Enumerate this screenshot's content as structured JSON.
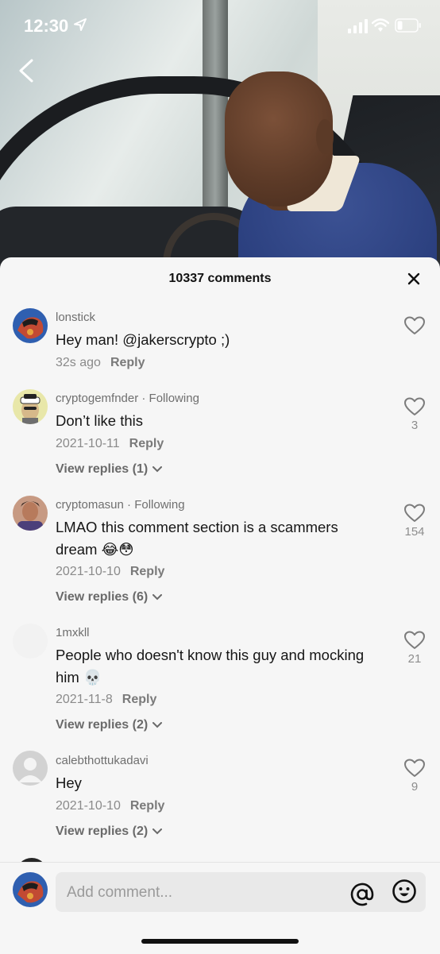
{
  "status_bar": {
    "time": "12:30"
  },
  "sheet": {
    "comment_count_label": "10337 comments"
  },
  "comments": [
    {
      "username": "lonstick",
      "following": "",
      "text": "Hey man! @jakerscrypto ;)",
      "time": "32s ago",
      "reply_label": "Reply",
      "likes": "",
      "view_replies": ""
    },
    {
      "username": "cryptogemfnder",
      "following": " · Following",
      "text": "Don’t like this",
      "time": "2021-10-11",
      "reply_label": "Reply",
      "likes": "3",
      "view_replies": "View replies (1)"
    },
    {
      "username": "cryptomasun",
      "following": " · Following",
      "text": "LMAO this comment section is a scammers dream 😂😳",
      "time": "2021-10-10",
      "reply_label": "Reply",
      "likes": "154",
      "view_replies": "View replies (6)"
    },
    {
      "username": "1mxkll",
      "following": "",
      "text": "People who doesn't know this guy and mocking him 💀",
      "time": "2021-11-8",
      "reply_label": "Reply",
      "likes": "21",
      "view_replies": "View replies (2)"
    },
    {
      "username": "calebthottukadavi",
      "following": "",
      "text": "Hey",
      "time": "2021-10-10",
      "reply_label": "Reply",
      "likes": "9",
      "view_replies": "View replies (2)"
    }
  ],
  "composer": {
    "placeholder": "Add comment..."
  },
  "icons": {
    "back": "chevron-left-icon",
    "close": "close-icon",
    "like": "heart-outline-icon",
    "mention": "at-sign-icon",
    "emoji": "smiley-icon"
  },
  "colors": {
    "sheet_bg": "#f6f6f6",
    "muted_text": "#8a8a8a"
  }
}
